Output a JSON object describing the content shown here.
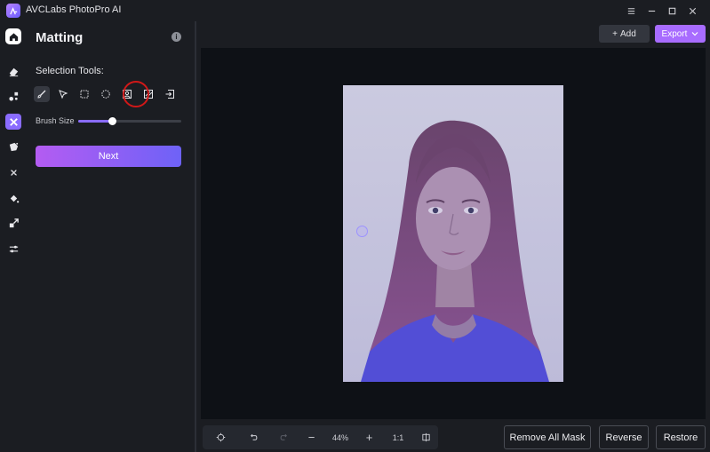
{
  "app": {
    "title": "AVCLabs PhotoPro AI"
  },
  "window_controls": [
    "menu-icon",
    "minimize-icon",
    "maximize-icon",
    "close-icon"
  ],
  "rail": {
    "items": [
      {
        "icon": "home-icon",
        "state": "home"
      },
      {
        "icon": "eraser-icon",
        "state": "normal"
      },
      {
        "icon": "shapes-icon",
        "state": "normal"
      },
      {
        "icon": "matting-icon",
        "state": "active"
      },
      {
        "icon": "face-enhance-icon",
        "state": "normal"
      },
      {
        "icon": "fan-icon",
        "state": "normal"
      },
      {
        "icon": "paint-bucket-icon",
        "state": "normal"
      },
      {
        "icon": "expand-icon",
        "state": "normal"
      },
      {
        "icon": "sliders-icon",
        "state": "normal"
      }
    ]
  },
  "panel": {
    "title": "Matting",
    "info_icon": "i",
    "selection_label": "Selection Tools:",
    "tools": [
      {
        "icon": "brush-icon",
        "active": true
      },
      {
        "icon": "pointer-icon",
        "active": false
      },
      {
        "icon": "rect-select-icon",
        "active": false
      },
      {
        "icon": "ellipse-select-icon",
        "active": false
      },
      {
        "icon": "portrait-select-icon",
        "active": false,
        "highlighted": true
      },
      {
        "icon": "hatch-select-icon",
        "active": false
      },
      {
        "icon": "import-icon",
        "active": false
      }
    ],
    "brush_size_label": "Brush Size",
    "brush_size_value": 0.33,
    "next_label": "Next"
  },
  "topbar": {
    "add_label": "Add",
    "add_icon": "+",
    "export_label": "Export"
  },
  "zoom": {
    "level": "44%",
    "ratio_label": "1:1",
    "minus": "−",
    "plus": "+"
  },
  "actions": {
    "remove_all_mask": "Remove All Mask",
    "reverse": "Reverse",
    "restore": "Restore"
  },
  "colors": {
    "accent": "#8a6cff",
    "export": "#a86cff",
    "next_gradient_start": "#b45cf2",
    "next_gradient_end": "#6e62f7",
    "highlight_ring": "#d01818"
  }
}
